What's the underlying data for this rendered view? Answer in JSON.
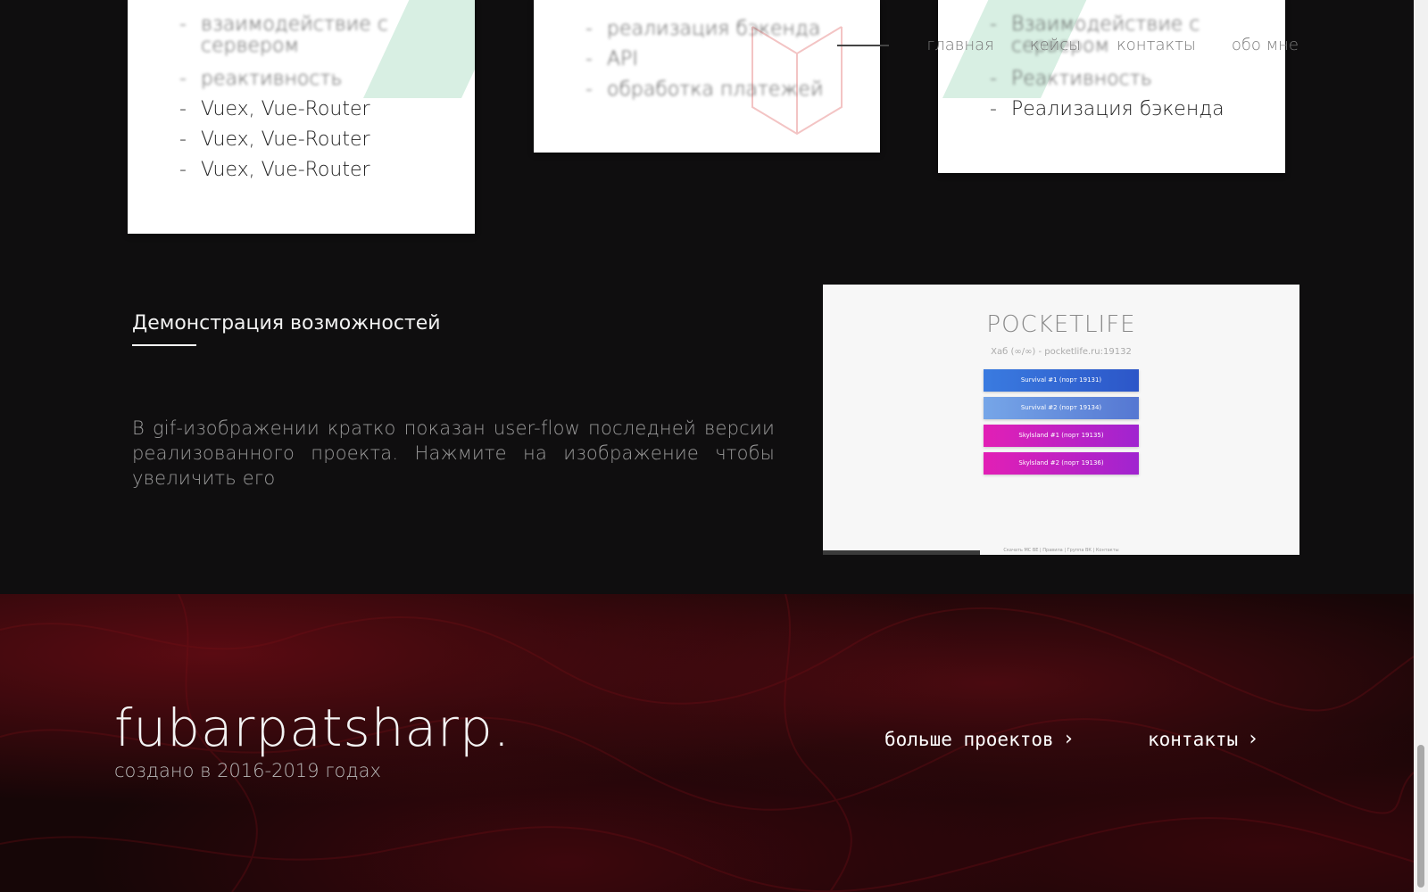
{
  "nav": {
    "items": [
      "главная",
      "кейсы",
      "контакты",
      "обо мне"
    ]
  },
  "cards": {
    "left": {
      "items": [
        "взаимодействие с сервером",
        "реактивность",
        "Vuex, Vue-Router",
        "Vuex, Vue-Router",
        "Vuex, Vue-Router"
      ]
    },
    "middle": {
      "items": [
        "реализация бэкенда",
        "API",
        "обработка платежей"
      ]
    },
    "right": {
      "items": [
        "Взаимодействие с сервером",
        "Реактивность",
        "Реализация бэкенда"
      ]
    }
  },
  "demo": {
    "title": "Демонстрация возможностей",
    "text": "В gif-изображении кратко показан user-flow последней версии реализованного проекта. Нажмите на изображение чтобы увеличить его",
    "preview": {
      "logo": "POCKETLIFE",
      "subtitle": "Хаб (∞/∞) - pocketlife.ru:19132",
      "buttons": [
        "Survival #1 (порт 19131)",
        "Survival #2 (порт 19134)",
        "Skylsland #1 (порт 19135)",
        "Skylsland #2 (порт 19136)"
      ],
      "footer": "Скачать MC BE | Правила | Группа ВК | Контакты"
    }
  },
  "footer": {
    "brand": "fubarpatsharp.",
    "subtitle": "создано в 2016-2019 годах",
    "more_projects": "больше проектов",
    "contacts": "контакты"
  },
  "colors": {
    "background": "#0f0e0f",
    "footer_red": "#5a0b12",
    "preview_blue": "#3a7be0",
    "preview_magenta": "#e21fb5"
  }
}
